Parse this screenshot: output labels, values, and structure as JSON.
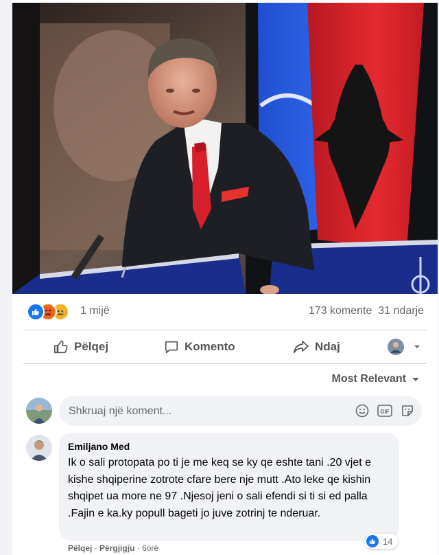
{
  "post": {
    "reactions": {
      "icons": [
        "like-icon",
        "angry-icon",
        "sad-icon"
      ],
      "count": "1 mijë"
    },
    "comments_count": "173 komente",
    "shares_count": "31 ndarje"
  },
  "actions": {
    "like": "Pëlqej",
    "comment": "Komento",
    "share": "Ndaj"
  },
  "sort": {
    "label": "Most Relevant"
  },
  "composer": {
    "placeholder": "Shkruaj një koment...",
    "icons": [
      "emoji-icon",
      "gif-icon",
      "sticker-icon"
    ]
  },
  "comment": {
    "author": "Emiljano Med",
    "text": "Ik o sali protopata po ti je me keq se ky qe eshte tani .20 vjet e kishe shqiperine zotrote cfare bere nje mutt .Ato leke qe kishin shqipet ua more ne 97 .Njesoj jeni o sali efendi si ti si ed palla .Fajin e ka.ky popull bageti jo juve zotrinj te nderuar.",
    "like_count": "14",
    "like_label": "Pëlqej",
    "reply_label": "Përgjigju",
    "time": "6orë"
  },
  "colors": {
    "accent": "#1877f2",
    "flag_red": "#d8202a",
    "bubble": "#f0f2f5"
  }
}
